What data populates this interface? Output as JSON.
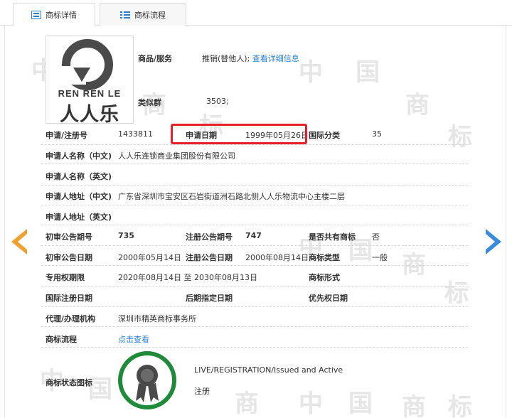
{
  "tabs": [
    {
      "label": "商标详情",
      "icon": "detail-icon",
      "active": true
    },
    {
      "label": "商标流程",
      "icon": "list-icon",
      "active": false
    }
  ],
  "watermark": {
    "chars": [
      "中",
      "国",
      "商",
      "标"
    ]
  },
  "logo": {
    "brand_text": "REN REN LE",
    "cn_text": "人人乐"
  },
  "goods": {
    "label": "商品/服务",
    "value": "推销(替他人);",
    "link": "查看详细信息"
  },
  "similar_group": {
    "label": "类似群",
    "value": "3503;"
  },
  "fields": {
    "reg_no": {
      "label": "申请/注册号",
      "value": "1433811"
    },
    "apply_date": {
      "label": "申请日期",
      "value": "1999年05月26日"
    },
    "intl_class": {
      "label": "国际分类",
      "value": "35"
    },
    "applicant_cn": {
      "label": "申请人名称（中文)",
      "value": "人人乐连锁商业集团股份有限公司"
    },
    "applicant_en": {
      "label": "申请人名称（英文)",
      "value": ""
    },
    "address_cn": {
      "label": "申请人地址（中文)",
      "value": "广东省深圳市宝安区石岩街道洲石路北侧人人乐物流中心主楼二层"
    },
    "address_en": {
      "label": "申请人地址（英文)",
      "value": ""
    },
    "first_pub_no": {
      "label": "初审公告期号",
      "value": "735"
    },
    "reg_pub_no": {
      "label": "注册公告期号",
      "value": "747"
    },
    "shared": {
      "label": "是否共有商标",
      "value": "否"
    },
    "first_pub_date": {
      "label": "初审公告日期",
      "value": "2000年05月14日"
    },
    "reg_pub_date": {
      "label": "注册公告日期",
      "value": "2000年08月14日"
    },
    "mark_type": {
      "label": "商标类型",
      "value": "一般"
    },
    "exclusive_period": {
      "label": "专用权期限",
      "value": "2020年08月14日 至 2030年08月13日"
    },
    "mark_form": {
      "label": "商标形式",
      "value": ""
    },
    "intl_reg_date": {
      "label": "国际注册日期",
      "value": ""
    },
    "later_designation_date": {
      "label": "后期指定日期",
      "value": ""
    },
    "priority_date": {
      "label": "优先权日期",
      "value": ""
    },
    "agency": {
      "label": "代理/办理机构",
      "value": "深圳市精英商标事务所"
    },
    "process": {
      "label": "商标流程",
      "link": "点击查看"
    },
    "status_icon": {
      "label": "商标状态图标",
      "status_en": "LIVE/REGISTRATION/Issued and Active",
      "status_cn": "注册"
    }
  },
  "colors": {
    "accent": "#2a7fd4",
    "highlight": "#e8202a",
    "prev_arrow": "#f0a02c",
    "next_arrow": "#3a8be0",
    "status_ring": "#1e8a3a"
  }
}
